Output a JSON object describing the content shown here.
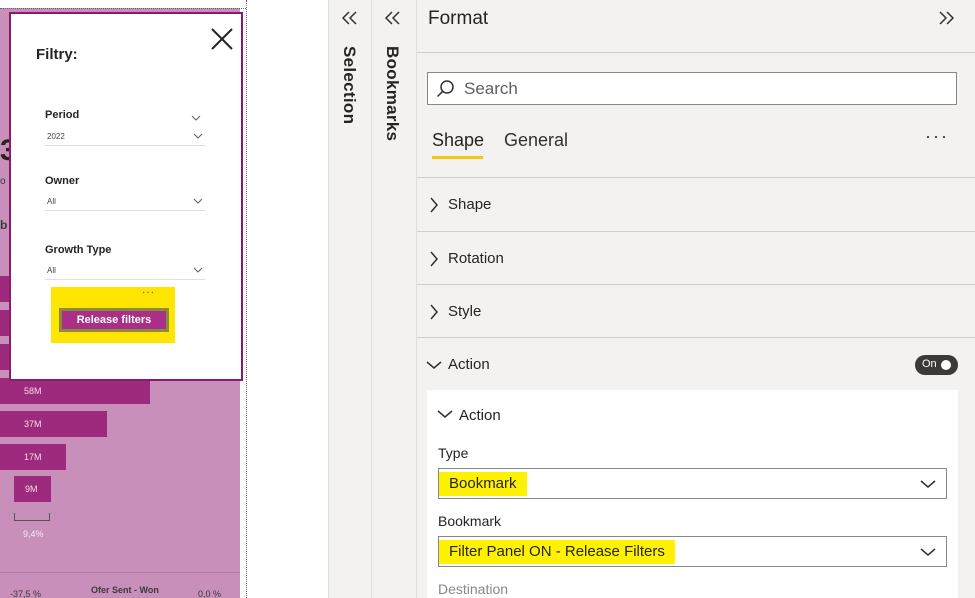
{
  "canvas": {
    "filter_panel": {
      "title": "Filtry:",
      "filters": [
        {
          "label": "Period",
          "value": "2022"
        },
        {
          "label": "Owner",
          "value": "All"
        },
        {
          "label": "Growth Type",
          "value": "All"
        }
      ],
      "more": "...",
      "button_label": "Release filters"
    },
    "bars": [
      {
        "label": "58M"
      },
      {
        "label": "37M"
      },
      {
        "label": "17M"
      },
      {
        "label": "9M"
      }
    ],
    "fragments": {
      "number_partial": "3",
      "small_o": "o",
      "small_b": "b",
      "percent": "9,4%",
      "bottom_left": "-37,5 %",
      "bottom_mid": "Ofer Sent - Won",
      "bottom_right": "0,0 %"
    }
  },
  "panes": {
    "selection": "Selection",
    "bookmarks": "Bookmarks"
  },
  "format": {
    "title": "Format",
    "search_placeholder": "Search",
    "tabs": [
      {
        "label": "Shape",
        "active": true
      },
      {
        "label": "General",
        "active": false
      }
    ],
    "more": "···",
    "sections": [
      {
        "label": "Shape",
        "expanded": false
      },
      {
        "label": "Rotation",
        "expanded": false
      },
      {
        "label": "Style",
        "expanded": false
      },
      {
        "label": "Action",
        "expanded": true
      }
    ],
    "action_toggle": "On",
    "action_card": {
      "title": "Action",
      "type_label": "Type",
      "type_value": "Bookmark",
      "bookmark_label": "Bookmark",
      "bookmark_value": "Filter Panel ON - Release Filters",
      "destination_label": "Destination"
    }
  },
  "colors": {
    "accent_yellow": "#f2c811",
    "highlight": "#fff200",
    "brand_magenta": "#9e2a7e"
  }
}
